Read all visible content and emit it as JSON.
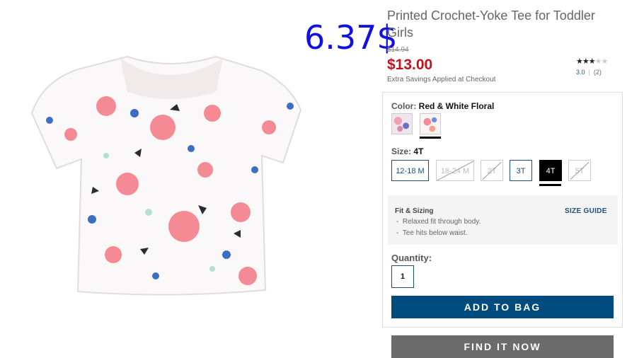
{
  "overlay_price": "6.37$",
  "product": {
    "title": "Printed Crochet-Yoke Tee for Toddler Girls",
    "original_price": "$14.94",
    "sale_price": "$13.00",
    "savings_note": "Extra Savings Applied at Checkout",
    "rating": {
      "value": "3.0",
      "count": "(2)",
      "stars_filled": 3,
      "stars_total": 5
    }
  },
  "color": {
    "label": "Color:",
    "selected": "Red & White Floral",
    "swatches": [
      "purple-floral-swatch",
      "red-white-floral-swatch"
    ],
    "selected_index": 1
  },
  "size": {
    "label": "Size:",
    "selected": "4T",
    "options": [
      {
        "label": "12-18 M",
        "available": true
      },
      {
        "label": "18-24 M",
        "available": false
      },
      {
        "label": "2T",
        "available": false
      },
      {
        "label": "3T",
        "available": true
      },
      {
        "label": "4T",
        "available": true,
        "selected": true
      },
      {
        "label": "5T",
        "available": false
      }
    ]
  },
  "fit": {
    "title": "Fit & Sizing",
    "size_guide": "SIZE GUIDE",
    "bullets": [
      "Relaxed fit through body.",
      "Tee hits below waist."
    ]
  },
  "quantity": {
    "label": "Quantity:",
    "value": "1"
  },
  "buttons": {
    "add_to_bag": "ADD TO BAG",
    "find_it_now": "FIND IT NOW"
  },
  "colors": {
    "accent": "#004b7d",
    "sale": "#c1121f",
    "overlay": "#1010e6"
  }
}
